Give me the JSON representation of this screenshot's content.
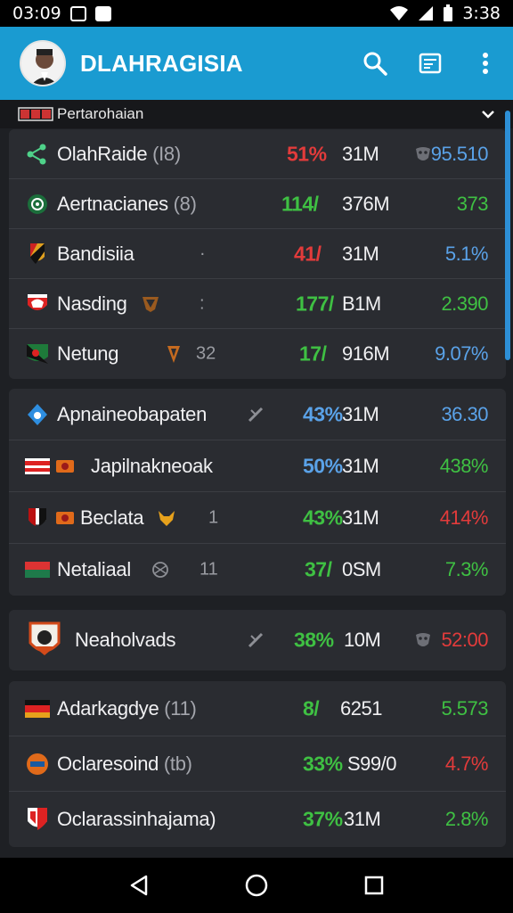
{
  "status": {
    "time_left": "03:09",
    "time_right": "3:38"
  },
  "appbar": {
    "title": "DLAHRAGISIA"
  },
  "section": {
    "label": "Pertarohaian"
  },
  "colors": {
    "accent": "#1a9bd1",
    "red": "#e23b3b",
    "green": "#3fc043",
    "blue": "#5aa2e8"
  },
  "group1": [
    {
      "name": "OlahRaide",
      "suffix": "(I8)",
      "mid": "",
      "change": "51%",
      "change_color": "red",
      "volume": "31M",
      "value": "95.510",
      "value_color": "blue",
      "icon": "share-icon"
    },
    {
      "name": "Aertnacianes",
      "suffix": "(8)",
      "mid": "",
      "change": "114/",
      "change_color": "green",
      "volume": "376M",
      "value": "373",
      "value_color": "green",
      "icon": "ball-icon"
    },
    {
      "name": "Bandisiia",
      "suffix": "",
      "mid": "·",
      "change": "41/",
      "change_color": "red",
      "volume": "31M",
      "value": "5.1%",
      "value_color": "blue",
      "icon": "shield-icon"
    },
    {
      "name": "Nasding",
      "suffix": "",
      "mid": ":",
      "change": "177/",
      "change_color": "green",
      "volume": "B1M",
      "value": "2.390",
      "value_color": "green",
      "icon": "crest-icon"
    },
    {
      "name": "Netung",
      "suffix": "",
      "mid": "32",
      "change": "17/",
      "change_color": "green",
      "volume": "916M",
      "value": "9.07%",
      "value_color": "blue",
      "icon": "flag-icon"
    }
  ],
  "group2": [
    {
      "name": "Apnaineobapaten",
      "mid": "",
      "change": "43%",
      "change_color": "blue",
      "volume": "31M",
      "value": "36.30",
      "value_color": "blue",
      "icon": "drop-icon"
    },
    {
      "name": "Japilnakneoak",
      "mid": "",
      "change": "50%",
      "change_color": "blue",
      "volume": "31M",
      "value": "438%",
      "value_color": "green",
      "icon": "flag-icon"
    },
    {
      "name": "Beclata",
      "mid": "1",
      "change": "43%",
      "change_color": "green",
      "volume": "31M",
      "value": "414%",
      "value_color": "red",
      "icon": "flag-icon"
    },
    {
      "name": "Netaliaal",
      "mid": "11",
      "change": "37/",
      "change_color": "green",
      "volume": "0SM",
      "value": "7.3%",
      "value_color": "green",
      "icon": "flag-icon"
    }
  ],
  "group3": [
    {
      "name": "Neaholvads",
      "change": "38%",
      "change_color": "green",
      "volume": "10M",
      "value": "52:00",
      "value_color": "red",
      "icon": "crest-icon"
    }
  ],
  "group4": [
    {
      "name": "Adarkagdye",
      "suffix": "(11)",
      "change": "8/",
      "change_color": "green",
      "volume": "6251",
      "value": "5.573",
      "value_color": "green",
      "icon": "flag-icon"
    },
    {
      "name": "Oclaresoind",
      "suffix": "(tb)",
      "change": "33%",
      "change_color": "green",
      "volume": "S99/0",
      "value": "4.7%",
      "value_color": "red",
      "icon": "crest-icon"
    },
    {
      "name": "Oclarassinhajama)",
      "suffix": "",
      "change": "37%",
      "change_color": "green",
      "volume": "31M",
      "value": "2.8%",
      "value_color": "green",
      "icon": "shield-icon"
    }
  ]
}
